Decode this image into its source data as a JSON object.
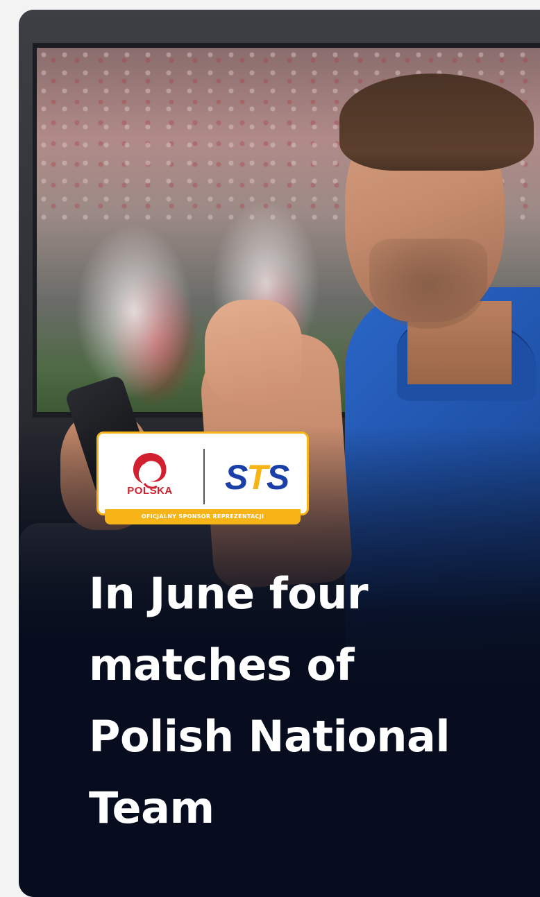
{
  "promo_card": {
    "headline": "In June four matches of Polish National Team",
    "badge": {
      "left_logo_text": "POLSKA",
      "right_logo_text_s1": "S",
      "right_logo_text_t": "T",
      "right_logo_text_s2": "S",
      "strip_text": "OFICJALNY SPONSOR REPREZENTACJI"
    }
  },
  "colors": {
    "card_background": "#070d1e",
    "page_background": "#f3f3f4",
    "badge_border": "#f6b417",
    "sts_blue": "#1a3fa8",
    "polska_red": "#d1202f",
    "headline_text": "#ffffff"
  }
}
